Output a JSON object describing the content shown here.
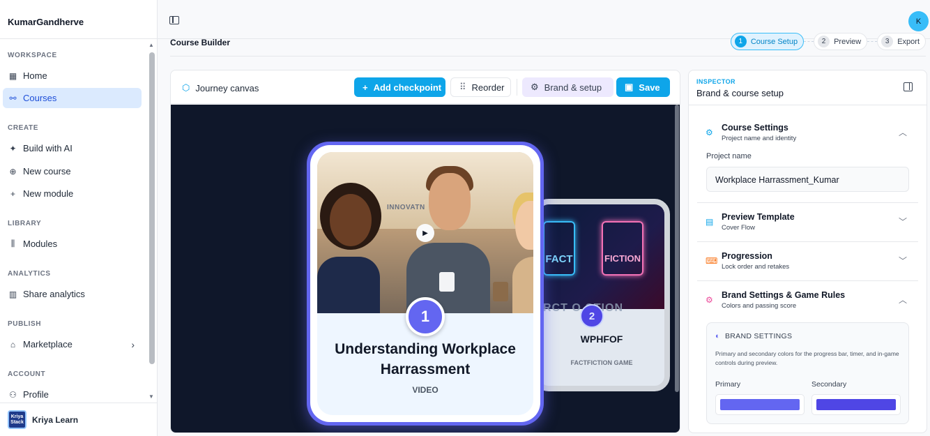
{
  "app": {
    "brand_name": "KumarGandherve",
    "avatar_initial": "K"
  },
  "sidebar": {
    "sections": [
      {
        "title": "WORKSPACE",
        "items": [
          {
            "label": "Home",
            "icon": "grid-icon"
          },
          {
            "label": "Courses",
            "icon": "route-icon",
            "active": true
          }
        ]
      },
      {
        "title": "CREATE",
        "items": [
          {
            "label": "Build with AI",
            "icon": "sparkles-icon"
          },
          {
            "label": "New course",
            "icon": "plus-circle-icon"
          },
          {
            "label": "New module",
            "icon": "plus-icon"
          }
        ]
      },
      {
        "title": "LIBRARY",
        "items": [
          {
            "label": "Modules",
            "icon": "library-icon"
          }
        ]
      },
      {
        "title": "ANALYTICS",
        "items": [
          {
            "label": "Share analytics",
            "icon": "bar-chart-icon"
          }
        ]
      },
      {
        "title": "PUBLISH",
        "items": [
          {
            "label": "Marketplace",
            "icon": "store-icon"
          }
        ]
      },
      {
        "title": "ACCOUNT",
        "items": [
          {
            "label": "Profile",
            "icon": "user-icon"
          }
        ]
      }
    ],
    "footer": {
      "label": "Kriya Learn",
      "logo_text": "Kriya Stack"
    }
  },
  "header": {
    "page_title": "Course Builder",
    "steps": [
      {
        "num": "1",
        "label": "Course Setup",
        "active": true
      },
      {
        "num": "2",
        "label": "Preview"
      },
      {
        "num": "3",
        "label": "Export"
      }
    ]
  },
  "canvas": {
    "title": "Journey canvas",
    "buttons": {
      "add_checkpoint": "Add checkpoint",
      "reorder": "Reorder",
      "brand_setup": "Brand & setup",
      "save": "Save"
    },
    "cards": [
      {
        "num": "1",
        "title": "Understanding Workplace Harrassment",
        "type": "VIDEO",
        "sign_text": "INNOVATN"
      },
      {
        "num": "2",
        "title": "WPHFOF",
        "type": "FACTFICTION GAME",
        "fact_label": "FACT",
        "fiction_label": "FICTION",
        "overlay_text": "RCT O  CTION"
      }
    ]
  },
  "inspector": {
    "eyebrow": "INSPECTOR",
    "title": "Brand & course setup",
    "sections": [
      {
        "title": "Course Settings",
        "subtitle": "Project name and identity",
        "icon": "gear-icon",
        "expanded": true
      },
      {
        "title": "Preview Template",
        "subtitle": "Cover Flow",
        "icon": "layout-icon",
        "expanded": false
      },
      {
        "title": "Progression",
        "subtitle": "Lock order and retakes",
        "icon": "gamepad-icon",
        "expanded": false
      },
      {
        "title": "Brand Settings & Game Rules",
        "subtitle": "Colors and passing score",
        "icon": "gear-icon",
        "expanded": true
      }
    ],
    "project_name_label": "Project name",
    "project_name_value": "Workplace Harrassment_Kumar",
    "brand_settings": {
      "title": "BRAND SETTINGS",
      "description": "Primary and secondary colors for the progress bar, timer, and in-game controls during preview.",
      "primary_label": "Primary",
      "secondary_label": "Secondary",
      "primary_color": "#6366f1",
      "secondary_color": "#4f46e5"
    }
  },
  "colors": {
    "accent": "#0ea5e9",
    "card_accent": "#6366f1",
    "canvas_bg": "#0f172a"
  }
}
